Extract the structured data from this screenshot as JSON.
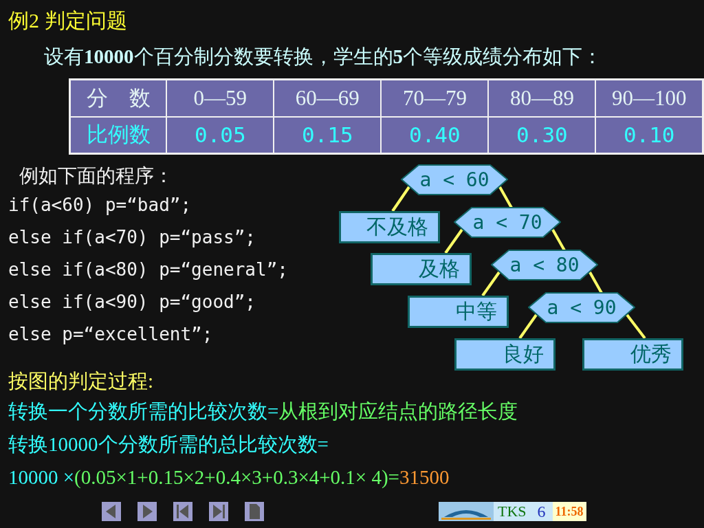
{
  "title": "例2  判定问题",
  "intro": "设有**10000**个百分制分数要转换，学生的**5**个等级成绩分布如下：",
  "table": {
    "rows": [
      {
        "kind": "header",
        "cells": [
          "分　数",
          "0—59",
          "60—69",
          "70—79",
          "80—89",
          "90—100"
        ]
      },
      {
        "kind": "ratio",
        "cells": [
          "比例数",
          "0.05",
          "0.15",
          "0.40",
          "0.30",
          "0.10"
        ]
      }
    ]
  },
  "program_label": "例如下面的程序：",
  "code_lines": [
    "if(a<60) p=“bad”;",
    "else if(a<70) p=“pass”;",
    "else if(a<80) p=“general”;",
    "else if(a<90) p=“good”;",
    "else p=“excellent”;"
  ],
  "decision_tree": {
    "kind": "test",
    "label": "a < 60",
    "children": [
      {
        "kind": "leaf",
        "label": "不及格"
      },
      {
        "kind": "test",
        "label": "a < 70",
        "children": [
          {
            "kind": "leaf",
            "label": "及格"
          },
          {
            "kind": "test",
            "label": "a < 80",
            "children": [
              {
                "kind": "leaf",
                "label": "中等"
              },
              {
                "kind": "test",
                "label": "a < 90",
                "children": [
                  {
                    "kind": "leaf",
                    "label": "良好"
                  },
                  {
                    "kind": "leaf",
                    "label": "优秀"
                  }
                ]
              }
            ]
          }
        ]
      }
    ]
  },
  "process_heading": "按图的判定过程:",
  "lines": [
    [
      {
        "kind": "term",
        "text": "转换一个分数所需的比较次数="
      },
      {
        "kind": "value",
        "text": "从根到对应结点的路径长度"
      }
    ],
    [
      {
        "kind": "term",
        "text": "转换10000个分数所需的总比较次数="
      }
    ],
    [
      {
        "kind": "term",
        "text": "10000 ×"
      },
      {
        "kind": "value",
        "text": "(0.05×1+0.15×2+0.4×3+0.3×4+0.1× 4)="
      },
      {
        "kind": "result",
        "text": "31500"
      }
    ]
  ],
  "status": {
    "label": "TKS",
    "page": "6",
    "time": "11:58"
  }
}
